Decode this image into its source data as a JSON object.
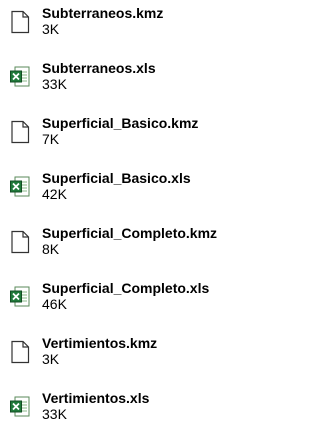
{
  "files": [
    {
      "name": "Subterraneos.kmz",
      "size": "3K",
      "icon": "generic-file-icon"
    },
    {
      "name": "Subterraneos.xls",
      "size": "33K",
      "icon": "excel-file-icon"
    },
    {
      "name": "Superficial_Basico.kmz",
      "size": "7K",
      "icon": "generic-file-icon"
    },
    {
      "name": "Superficial_Basico.xls",
      "size": "42K",
      "icon": "excel-file-icon"
    },
    {
      "name": "Superficial_Completo.kmz",
      "size": "8K",
      "icon": "generic-file-icon"
    },
    {
      "name": "Superficial_Completo.xls",
      "size": "46K",
      "icon": "excel-file-icon"
    },
    {
      "name": "Vertimientos.kmz",
      "size": "3K",
      "icon": "generic-file-icon"
    },
    {
      "name": "Vertimientos.xls",
      "size": "33K",
      "icon": "excel-file-icon"
    }
  ],
  "colors": {
    "excel_green": "#1f7a3a",
    "file_outline": "#333333"
  }
}
